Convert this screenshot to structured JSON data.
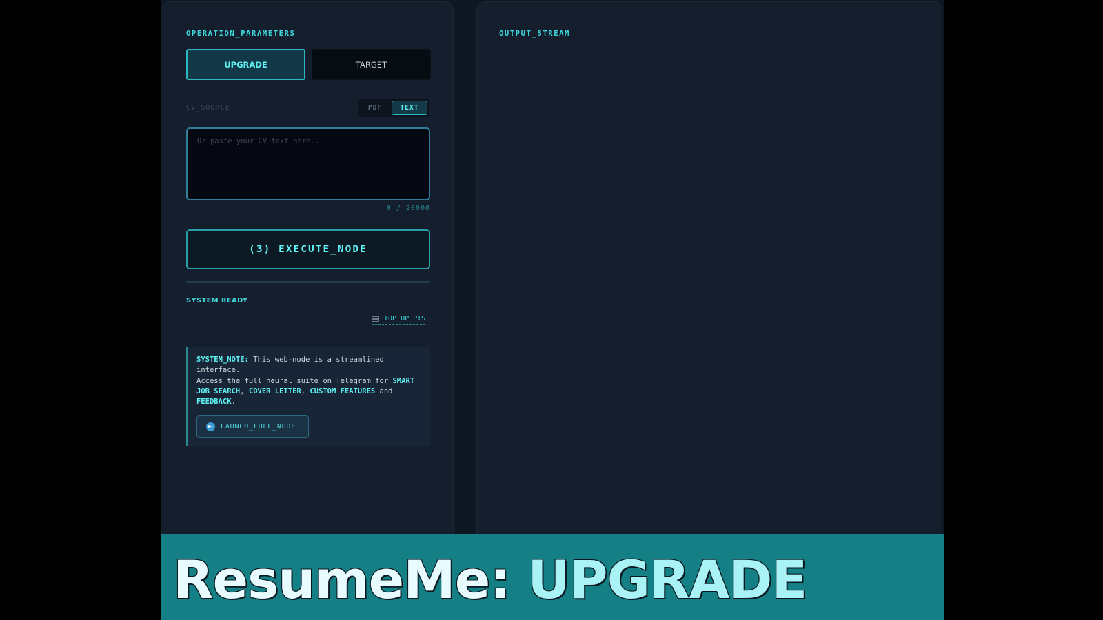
{
  "left_panel": {
    "title": "OPERATION_PARAMETERS",
    "modes": {
      "upgrade": "UPGRADE",
      "target": "TARGET"
    },
    "cv_source": {
      "label": "CV_SOURCE",
      "options": {
        "pdf": "PDF",
        "text": "TEXT"
      },
      "placeholder": "Or paste your CV text here...",
      "value": "",
      "char_count": "0 / 20000"
    },
    "execute_label": "(3) EXECUTE_NODE",
    "progress_fraction": 1.0,
    "status": "SYSTEM READY",
    "topup_label": "TOP_UP_PTS",
    "note": {
      "prefix": "SYSTEM_NOTE:",
      "line1": " This web-node is a streamlined interface.",
      "line2": "Access the full neural suite on Telegram for ",
      "f1": "SMART JOB SEARCH",
      "sep1": ", ",
      "f2": "COVER LETTER",
      "sep2": ", ",
      "f3": "CUSTOM FEATURES",
      "and": " and ",
      "f4": "FEEDBACK",
      "end": "."
    },
    "launch_label": "LAUNCH_FULL_NODE"
  },
  "right_panel": {
    "title": "OUTPUT_STREAM"
  },
  "caption": {
    "brand": "ResumeMe:",
    "mode": "UPGRADE"
  },
  "colors": {
    "accent": "#3fd8dd",
    "background": "#0f1722",
    "caption_bar": "#147f84"
  }
}
